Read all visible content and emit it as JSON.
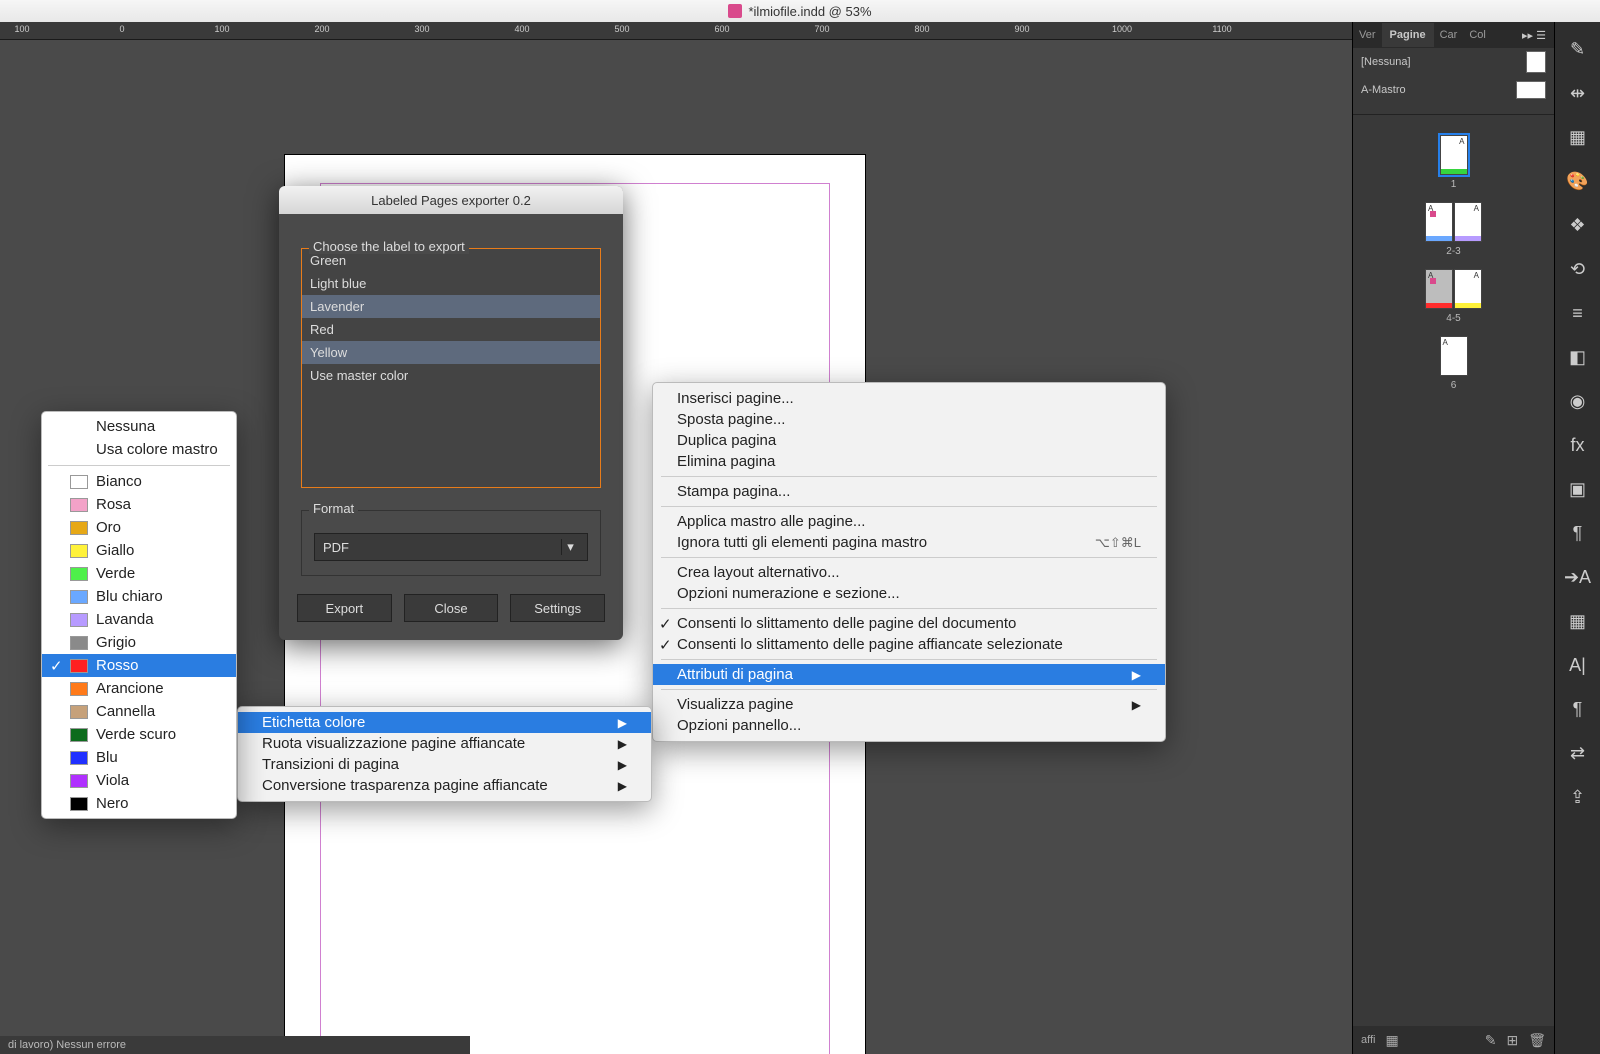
{
  "title": "*ilmiofile.indd @ 53%",
  "ruler_marks": [
    "100",
    "0",
    "100",
    "200",
    "300",
    "400",
    "500",
    "600",
    "700",
    "800",
    "900",
    "1000",
    "1100"
  ],
  "pages_panel": {
    "tabs": [
      "Ver",
      "Pagine",
      "Car",
      "Col"
    ],
    "master_none": "[Nessuna]",
    "master_a": "A-Mastro",
    "pages": [
      {
        "num": "1",
        "strip": "#36d43e",
        "a_right": "A",
        "selected": true
      },
      {
        "num": "2-3",
        "left": {
          "a_left": "A",
          "strip": "#6aa8ff",
          "dot": "#d94a8c"
        },
        "right": {
          "a_right": "A",
          "strip": "#b79bff"
        }
      },
      {
        "num": "4-5",
        "left": {
          "a_left": "A",
          "strip": "#ff2d2d",
          "sel": true,
          "dot": "#d94a8c"
        },
        "right": {
          "a_right": "A",
          "strip": "#fff23a"
        }
      },
      {
        "num": "6",
        "left": {
          "a_left": "A"
        }
      }
    ],
    "footer": "affi"
  },
  "dock_icons": [
    "wand-icon",
    "align-icon",
    "grid-icon",
    "palette-icon",
    "layers-icon",
    "link-icon",
    "lines-icon",
    "gradient-icon",
    "cc-icon",
    "fx-icon",
    "pathfinder-icon",
    "paragraph-icon",
    "char-style-icon",
    "table-icon",
    "type-icon",
    "pilcrow-icon",
    "swap-icon",
    "send-icon"
  ],
  "exporter": {
    "title": "Labeled Pages exporter 0.2",
    "choose_label": "Choose the label to export",
    "items": [
      {
        "t": "Green",
        "sel": false
      },
      {
        "t": "Light blue",
        "sel": false
      },
      {
        "t": "Lavender",
        "sel": true
      },
      {
        "t": "Red",
        "sel": false
      },
      {
        "t": "Yellow",
        "sel": true
      },
      {
        "t": "Use master color",
        "sel": false
      }
    ],
    "format_label": "Format",
    "format_value": "PDF",
    "buttons": {
      "export": "Export",
      "close": "Close",
      "settings": "Settings"
    }
  },
  "ctx_main": {
    "items": [
      {
        "t": "Inserisci pagine..."
      },
      {
        "t": "Sposta pagine..."
      },
      {
        "t": "Duplica pagina"
      },
      {
        "t": "Elimina pagina"
      },
      {
        "sep": true
      },
      {
        "t": "Stampa pagina..."
      },
      {
        "sep": true
      },
      {
        "t": "Applica mastro alle pagine..."
      },
      {
        "t": "Ignora tutti gli elementi pagina mastro",
        "shortcut": "⌥⇧⌘L"
      },
      {
        "sep": true
      },
      {
        "t": "Crea layout alternativo..."
      },
      {
        "t": "Opzioni numerazione e sezione..."
      },
      {
        "sep": true
      },
      {
        "t": "Consenti lo slittamento delle pagine del documento",
        "checked": true
      },
      {
        "t": "Consenti lo slittamento delle pagine affiancate selezionate",
        "checked": true
      },
      {
        "sep": true
      },
      {
        "t": "Attributi di pagina",
        "highlight": true,
        "arrow": true
      },
      {
        "sep": true
      },
      {
        "t": "Visualizza pagine",
        "arrow": true
      },
      {
        "t": "Opzioni pannello..."
      }
    ]
  },
  "ctx_sub": {
    "items": [
      {
        "t": "Etichetta colore",
        "highlight": true,
        "arrow": true
      },
      {
        "t": "Ruota visualizzazione pagine affiancate",
        "arrow": true
      },
      {
        "t": "Transizioni di pagina",
        "arrow": true
      },
      {
        "t": "Conversione trasparenza pagine affiancate",
        "arrow": true
      }
    ]
  },
  "colormenu": {
    "items": [
      {
        "t": "Nessuna",
        "noswatch": true
      },
      {
        "t": "Usa colore mastro",
        "noswatch": true
      },
      {
        "sep": true
      },
      {
        "t": "Bianco",
        "c": "#ffffff"
      },
      {
        "t": "Rosa",
        "c": "#f3a2c8"
      },
      {
        "t": "Oro",
        "c": "#e6a817"
      },
      {
        "t": "Giallo",
        "c": "#fff23a"
      },
      {
        "t": "Verde",
        "c": "#4ef04a"
      },
      {
        "t": "Blu chiaro",
        "c": "#6aa8ff"
      },
      {
        "t": "Lavanda",
        "c": "#b79bff"
      },
      {
        "t": "Grigio",
        "c": "#8a8a8a"
      },
      {
        "t": "Rosso",
        "c": "#ff2020",
        "highlight": true,
        "checked": true
      },
      {
        "t": "Arancione",
        "c": "#ff7a1a"
      },
      {
        "t": "Cannella",
        "c": "#c6a17a"
      },
      {
        "t": "Verde scuro",
        "c": "#0c6b1c"
      },
      {
        "t": "Blu",
        "c": "#2030ff"
      },
      {
        "t": "Viola",
        "c": "#b030ff"
      },
      {
        "t": "Nero",
        "c": "#000000"
      }
    ]
  },
  "status": "di lavoro)       Nessun errore"
}
